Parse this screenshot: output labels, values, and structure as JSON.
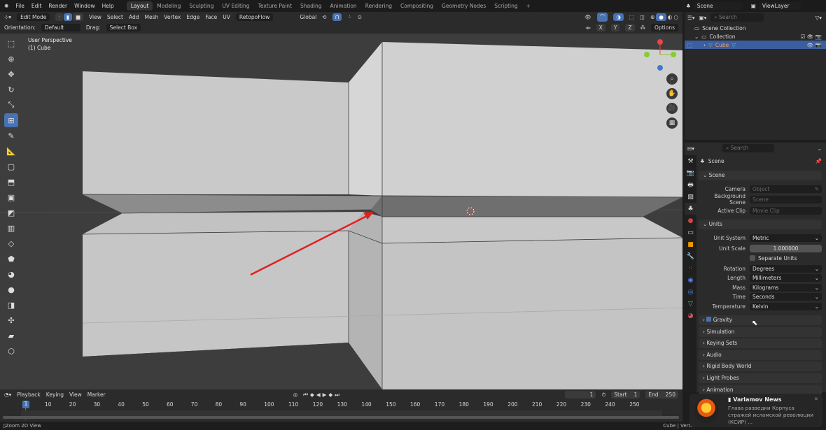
{
  "topbar": {
    "menus": [
      "File",
      "Edit",
      "Render",
      "Window",
      "Help"
    ],
    "workspaces": [
      "Layout",
      "Modeling",
      "Sculpting",
      "UV Editing",
      "Texture Paint",
      "Shading",
      "Animation",
      "Rendering",
      "Compositing",
      "Geometry Nodes",
      "Scripting",
      "+"
    ],
    "active_workspace": "Layout",
    "scene": "Scene",
    "view_layer": "ViewLayer"
  },
  "header": {
    "mode": "Edit Mode",
    "menus": [
      "View",
      "Select",
      "Add",
      "Mesh",
      "Vertex",
      "Edge",
      "Face",
      "UV"
    ],
    "addon": "RetopoFlow",
    "transform": "Global"
  },
  "tool_settings": {
    "orientation_label": "Orientation:",
    "orientation": "Default",
    "drag_label": "Drag:",
    "drag": "Select Box",
    "axes": [
      "X",
      "Y",
      "Z"
    ],
    "options": "Options"
  },
  "viewport": {
    "view_name": "User Perspective",
    "object_name": "(1) Cube",
    "annotation_color": "#e02020"
  },
  "outliner": {
    "search_placeholder": "Search",
    "items": [
      "Scene Collection",
      "Collection",
      "Cube"
    ]
  },
  "properties": {
    "search_placeholder": "Search",
    "context": "Scene",
    "scene_panel": {
      "title": "Scene",
      "camera_label": "Camera",
      "camera": "Object",
      "bg_label": "Background Scene",
      "bg": "Scene",
      "clip_label": "Active Clip",
      "clip": "Movie Clip"
    },
    "units_panel": {
      "title": "Units",
      "unit_system_label": "Unit System",
      "unit_system": "Metric",
      "unit_scale_label": "Unit Scale",
      "unit_scale": "1.000000",
      "separate_units": "Separate Units",
      "separate_units_checked": false,
      "rotation_label": "Rotation",
      "rotation": "Degrees",
      "length_label": "Length",
      "length": "Millimeters",
      "mass_label": "Mass",
      "mass": "Kilograms",
      "time_label": "Time",
      "time": "Seconds",
      "temperature_label": "Temperature",
      "temperature": "Kelvin"
    },
    "collapsed_panels": [
      "Gravity",
      "Simulation",
      "Keying Sets",
      "Audio",
      "Rigid Body World",
      "Light Probes",
      "Animation"
    ],
    "gravity_checked": true
  },
  "timeline": {
    "menus": [
      "Playback",
      "Keying",
      "View",
      "Marker"
    ],
    "current_frame": "1",
    "start_label": "Start",
    "start": "1",
    "end_label": "End",
    "end": "250",
    "ticks": [
      "10",
      "20",
      "30",
      "40",
      "50",
      "60",
      "70",
      "80",
      "90",
      "100",
      "110",
      "120",
      "130",
      "140",
      "150",
      "160",
      "170",
      "180",
      "190",
      "200",
      "210",
      "220",
      "230",
      "240",
      "250"
    ],
    "playhead": "1"
  },
  "status": {
    "left": "Zoom 2D View",
    "right": "Cube | Verts"
  },
  "notification": {
    "title": "Varlamov News",
    "body": "Глава разведки Корпуса стражей исламской революции (КСИР) ...",
    "logo_text": "Varlamov"
  }
}
